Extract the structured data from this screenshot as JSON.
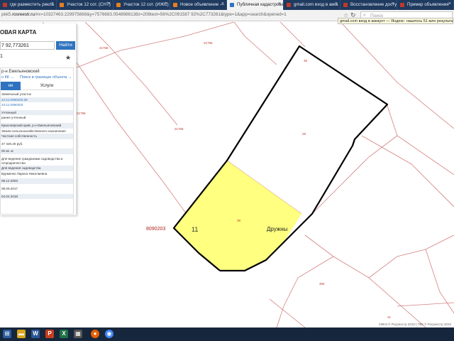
{
  "browser": {
    "tabs": [
      {
        "label": "где разместить рекла",
        "color": "#c0392b"
      },
      {
        "label": "Участок 12 сот. (СНТ)",
        "color": "#e67e22"
      },
      {
        "label": "Участок 12 сот. (ИЖС)",
        "color": "#e67e22"
      },
      {
        "label": "Новое объявление —",
        "color": "#e67e22"
      },
      {
        "label": "Публичная кадастрова",
        "color": "#2f73c0",
        "active": true
      },
      {
        "label": "gmail.com вход в акка",
        "color": "#c0392b"
      },
      {
        "label": "Восстановление досту",
        "color": "#c0392b"
      },
      {
        "label": "Пример объявления",
        "color": "#c0392b"
      }
    ],
    "url_prefix": "pkk5.",
    "url_domain": "rosreestr.ru",
    "url_rest": "/#x=10327463.229975669&y=7576693.0548986138z=208text=56%2C091587 92%2C773261&type=1&app=search&opened=1",
    "search_placeholder": "Поиск",
    "notification": "gmail.com вход в аккаунт — Яндекс: нашлось 51 млн результатов"
  },
  "panel": {
    "title": "ОВАЯ КАРТА",
    "search_value": "7 92,773261",
    "find_button": "Найти",
    "subtitle": "1",
    "card_head": "р-н Емельяновский",
    "link1": "н КК →",
    "link2": "Поиск в границах объекта →",
    "tab_active": "ия",
    "tab_other": "Услуги",
    "rows": [
      {
        "text": "Земельный участок",
        "style": ""
      },
      {
        "text": "24:11:0090203:39",
        "style": "bg link"
      },
      {
        "text": "24:11:0090203",
        "style": "link"
      },
      {
        "text": "Учтенный",
        "style": "bg gap"
      },
      {
        "text": "ранее учтенный",
        "style": ""
      },
      {
        "text": "Красноярский край, р-н Емельяновский",
        "style": "bg gap"
      },
      {
        "text": "Земли сельскохозяйственного назначения",
        "style": ""
      },
      {
        "text": "Частная собственность",
        "style": "bg"
      },
      {
        "text": "47 320,40 руб.",
        "style": "gap"
      },
      {
        "text": "00 кв. м",
        "style": "bg gap"
      },
      {
        "text": "Для ведения гражданами садоводства и огородничества",
        "style": "gap"
      },
      {
        "text": "Для ведения садоводства",
        "style": "bg"
      },
      {
        "text": "Бурменко Лариса Николаевна",
        "style": ""
      },
      {
        "text": "09.12.2003",
        "style": "bg gap"
      },
      {
        "text": "08.09.2017",
        "style": "gap"
      },
      {
        "text": "04.04.2018",
        "style": "bg gap"
      }
    ]
  },
  "map": {
    "labels": [
      "21766",
      "21796",
      "21766",
      "35",
      "29",
      "21766",
      "394",
      "41"
    ],
    "parcel_label_left": "8090203",
    "parcel_number": "11",
    "parcel_center": "39",
    "parcel_name": "Дружны",
    "footer": "СВКЭ © Росреестр 2010 | ПКК © Росреестр 2010"
  },
  "colors": {
    "parcel_fill": "#ffff80",
    "parcel_stroke": "#000000",
    "boundary": "#d48080",
    "accent": "#2f73c0",
    "taskbar": "#16263c"
  },
  "taskbar": {
    "icons": [
      "windows-icon",
      "folder-icon",
      "word-icon",
      "powerpoint-icon",
      "excel-icon",
      "calculator-icon",
      "firefox-icon",
      "chrome-icon"
    ]
  }
}
